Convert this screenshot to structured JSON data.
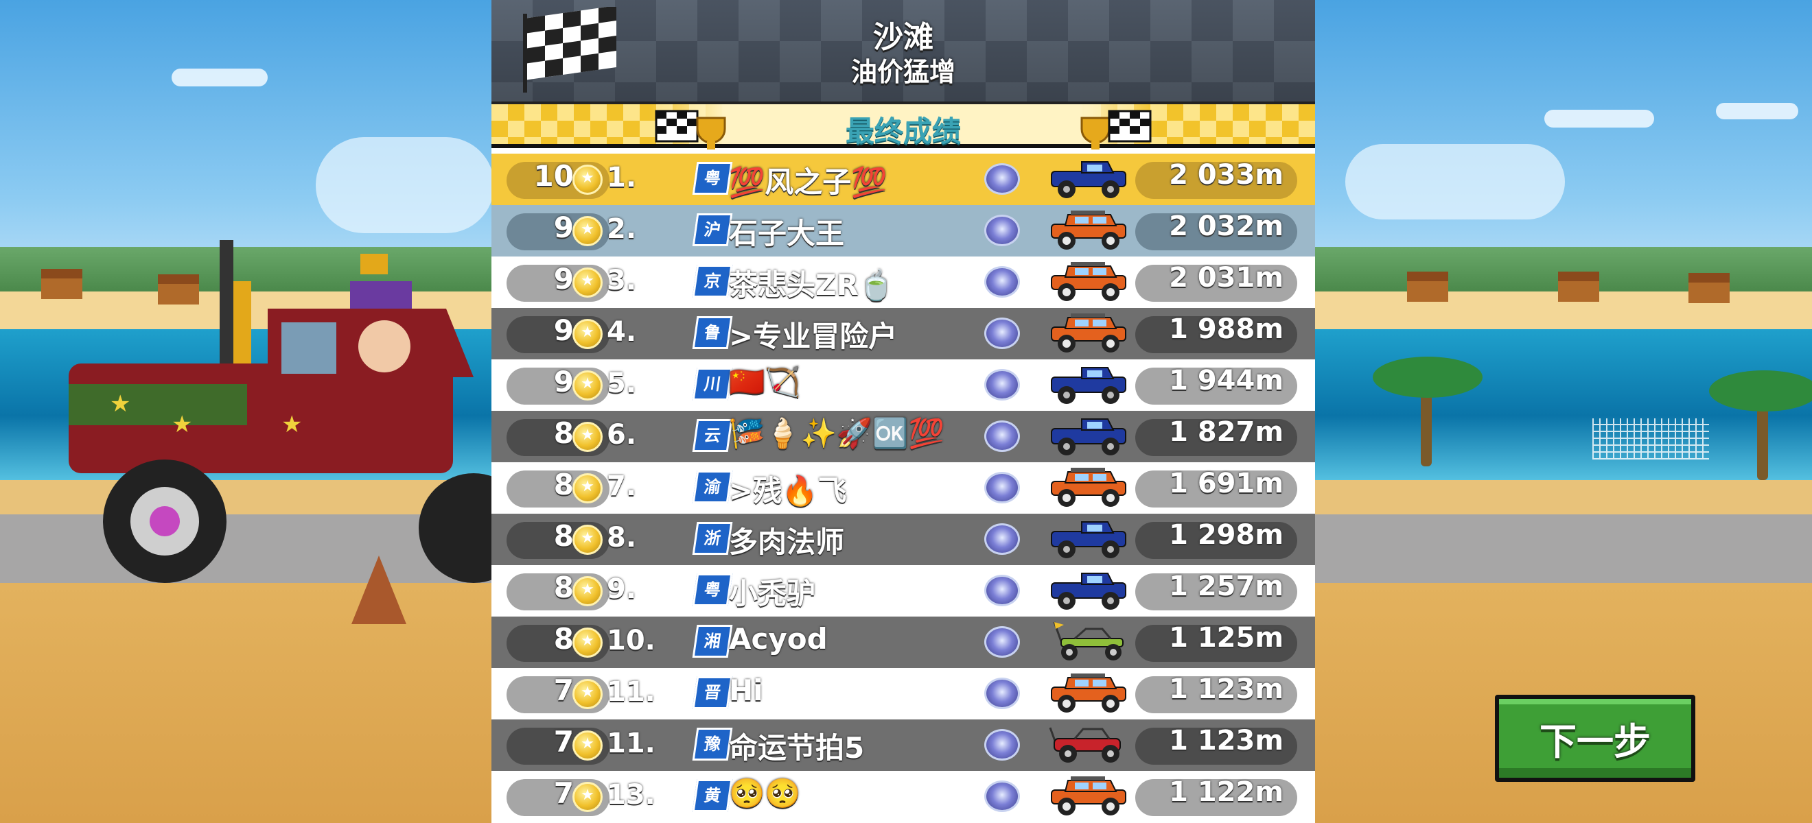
{
  "header": {
    "track_name": "沙滩",
    "event_name": "油价猛增",
    "banner_title": "最终成绩"
  },
  "colors": {
    "row_highlight": "#f5c83c",
    "row_self": "#9cb8c9",
    "row_light": "#ffffff",
    "row_dark": "#6f6f6f",
    "banner": "#f2c32b",
    "next_button": "#3e9f36"
  },
  "results": [
    {
      "points": "10",
      "rank": "1.",
      "region": "粤",
      "name": "💯风之子💯",
      "distance": "2 033m",
      "vehicle": "blue-pickup-icon",
      "style": "gold"
    },
    {
      "points": "9",
      "rank": "2.",
      "region": "沪",
      "name": "石子大王",
      "distance": "2 032m",
      "vehicle": "orange-jeep-icon",
      "style": "blue"
    },
    {
      "points": "9",
      "rank": "3.",
      "region": "京",
      "name": "茶悲头ZR🍵",
      "distance": "2 031m",
      "vehicle": "orange-jeep-icon",
      "style": "white"
    },
    {
      "points": "9",
      "rank": "4.",
      "region": "鲁",
      "name": ">专业冒险户",
      "distance": "1 988m",
      "vehicle": "orange-jeep-icon",
      "style": "dark"
    },
    {
      "points": "9",
      "rank": "5.",
      "region": "川",
      "name": "🇨🇳🏹",
      "distance": "1 944m",
      "vehicle": "blue-pickup-icon",
      "style": "white"
    },
    {
      "points": "8",
      "rank": "6.",
      "region": "云",
      "name": "🎏🍦✨🚀🆗💯",
      "distance": "1 827m",
      "vehicle": "blue-pickup-icon",
      "style": "dark"
    },
    {
      "points": "8",
      "rank": "7.",
      "region": "渝",
      "name": ">残🔥飞",
      "distance": "1 691m",
      "vehicle": "orange-jeep-icon",
      "style": "white"
    },
    {
      "points": "8",
      "rank": "8.",
      "region": "浙",
      "name": "多肉法师",
      "distance": "1 298m",
      "vehicle": "blue-pickup-icon",
      "style": "dark"
    },
    {
      "points": "8",
      "rank": "9.",
      "region": "粤",
      "name": "小秃驴",
      "distance": "1 257m",
      "vehicle": "blue-pickup-icon",
      "style": "white"
    },
    {
      "points": "8",
      "rank": "10.",
      "region": "湘",
      "name": "Acyod",
      "distance": "1 125m",
      "vehicle": "green-buggy-icon",
      "style": "dark"
    },
    {
      "points": "7",
      "rank": "11.",
      "region": "晋",
      "name": "Hi",
      "distance": "1 123m",
      "vehicle": "orange-jeep-icon",
      "style": "white"
    },
    {
      "points": "7",
      "rank": "11.",
      "region": "豫",
      "name": "命运节拍5",
      "distance": "1 123m",
      "vehicle": "red-rally-icon",
      "style": "dark"
    },
    {
      "points": "7",
      "rank": "13.",
      "region": "黄",
      "name": "🥺🥺",
      "distance": "1 122m",
      "vehicle": "orange-jeep-icon",
      "style": "white"
    }
  ],
  "next_button": {
    "label": "下一步"
  }
}
